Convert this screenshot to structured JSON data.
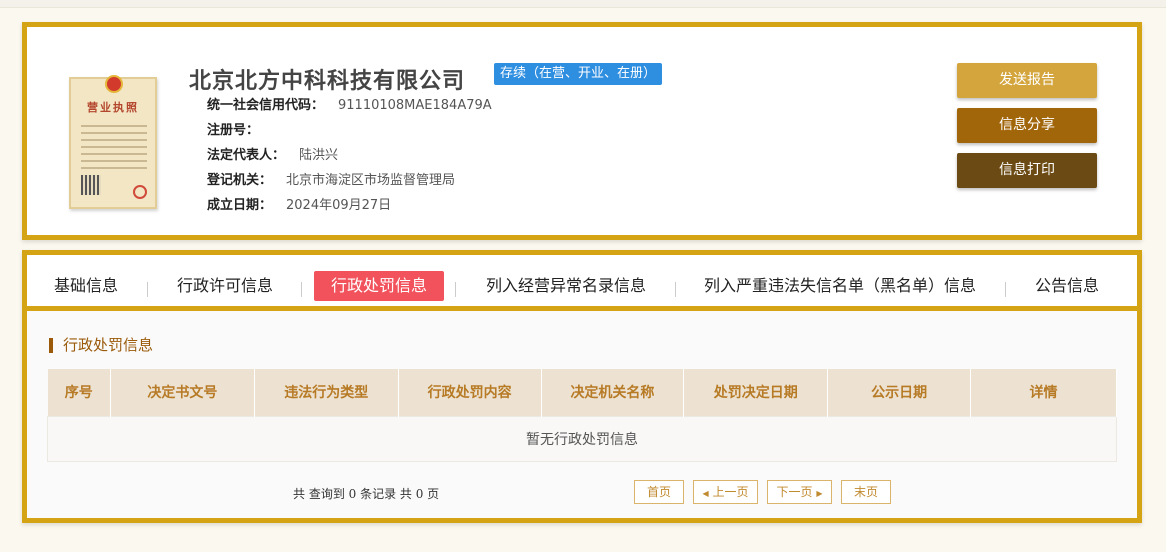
{
  "company": {
    "name": "北京北方中科科技有限公司",
    "status": "存续（在营、开业、在册）",
    "license_image": {
      "title": "营业执照"
    },
    "fields": [
      {
        "label": "统一社会信用代码：",
        "value": "91110108MAE184A79A"
      },
      {
        "label": "注册号：",
        "value": ""
      },
      {
        "label": "法定代表人：",
        "value": "陆洪兴"
      },
      {
        "label": "登记机关：",
        "value": "北京市海淀区市场监督管理局"
      },
      {
        "label": "成立日期：",
        "value": "2024年09月27日"
      }
    ]
  },
  "actions": {
    "send_report": "发送报告",
    "share_info": "信息分享",
    "print_info": "信息打印"
  },
  "tabs": [
    {
      "label": "基础信息",
      "active": false
    },
    {
      "label": "行政许可信息",
      "active": false
    },
    {
      "label": "行政处罚信息",
      "active": true
    },
    {
      "label": "列入经营异常名录信息",
      "active": false
    },
    {
      "label": "列入严重违法失信名单（黑名单）信息",
      "active": false
    },
    {
      "label": "公告信息",
      "active": false
    }
  ],
  "section": {
    "title": "行政处罚信息",
    "table": {
      "columns": [
        "序号",
        "决定书文号",
        "违法行为类型",
        "行政处罚内容",
        "决定机关名称",
        "处罚决定日期",
        "公示日期",
        "详情"
      ],
      "empty_text": "暂无行政处罚信息"
    }
  },
  "pagination": {
    "summary": "共 查询到 0 条记录 共 0 页",
    "first": "首页",
    "prev": "上一页",
    "next": "下一页",
    "last": "末页"
  },
  "colors": {
    "border_gold": "#d4a414",
    "status_blue": "#2e8ee0",
    "active_tab_red": "#f1525c",
    "btn_report": "#d3a53c",
    "btn_share": "#a2660a",
    "btn_print": "#6b4a14"
  }
}
